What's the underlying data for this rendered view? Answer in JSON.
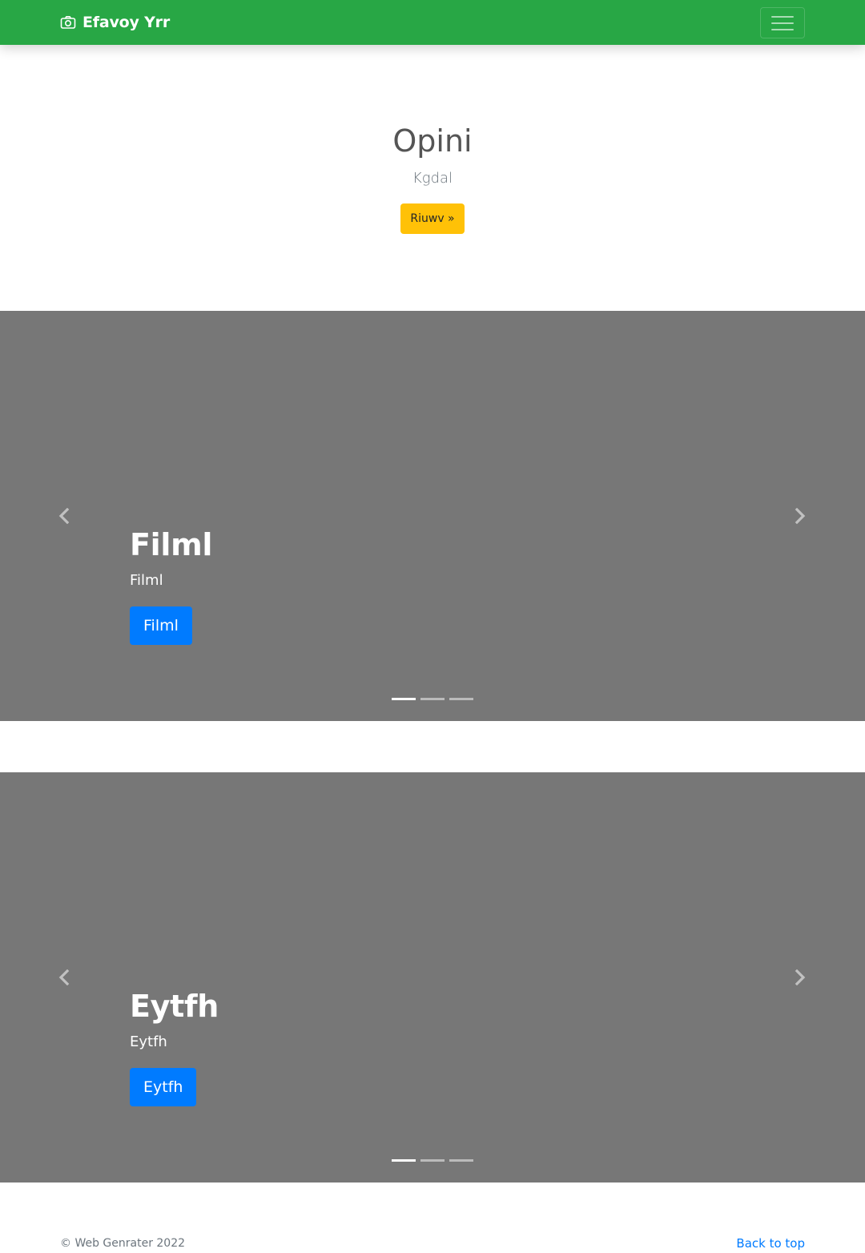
{
  "navbar": {
    "brand": "Efavoy Yrr",
    "brand_icon": "camera-icon",
    "toggler_icon": "hamburger-icon",
    "color": "#28a745"
  },
  "hero": {
    "title": "Opini",
    "subtitle": "Kgdal",
    "button_label": "Riuwv »",
    "button_color": "#ffc107"
  },
  "carousels": [
    {
      "title": "Filml",
      "subtitle": "Filml",
      "button_label": "Filml",
      "slide_count": 3,
      "active_slide": 1,
      "prev_icon": "chevron-left-icon",
      "next_icon": "chevron-right-icon"
    },
    {
      "title": "Eytfh",
      "subtitle": "Eytfh",
      "button_label": "Eytfh",
      "slide_count": 3,
      "active_slide": 1,
      "prev_icon": "chevron-left-icon",
      "next_icon": "chevron-right-icon"
    }
  ],
  "footer": {
    "copyright": "© Web Genrater 2022",
    "back_to_top": "Back to top"
  },
  "colors": {
    "carousel_bg": "#777777",
    "primary_button": "#007bff",
    "link": "#007bff"
  }
}
